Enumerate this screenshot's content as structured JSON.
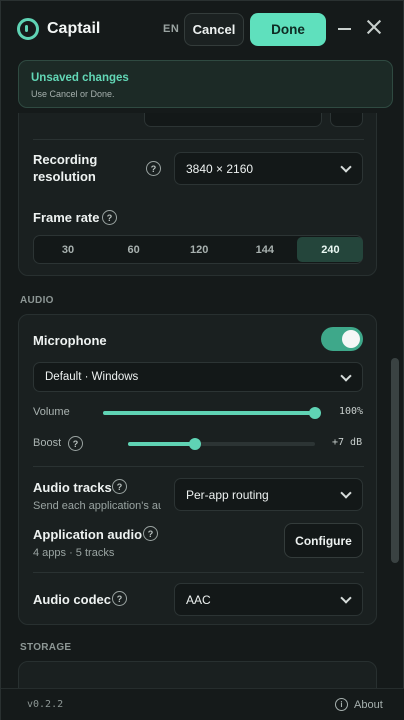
{
  "app": {
    "title": "Captail",
    "language": "EN",
    "logo_icon": "record-icon"
  },
  "header": {
    "cancel_label": "Cancel",
    "done_label": "Done"
  },
  "banner": {
    "title": "Unsaved changes",
    "subtitle": "Use Cancel or Done."
  },
  "video": {
    "resolution": {
      "label": "Recording resolution",
      "value": "3840 × 2160"
    },
    "frame_rate": {
      "label": "Frame rate",
      "options": [
        "30",
        "60",
        "120",
        "144",
        "240"
      ],
      "selected": "240"
    }
  },
  "audio": {
    "section_title": "AUDIO",
    "microphone": {
      "label": "Microphone",
      "enabled": true,
      "device": "Default · Windows"
    },
    "volume": {
      "label": "Volume",
      "value_text": "100%",
      "level": 1.0
    },
    "boost": {
      "label": "Boost",
      "value_text": "+7 dB",
      "level": 0.36
    },
    "audio_tracks": {
      "label": "Audio tracks",
      "description": "Send each application's audio to its own track",
      "value": "Per-app routing"
    },
    "application_audio": {
      "label": "Application audio",
      "summary": "4 apps · 5 tracks",
      "button": "Configure"
    },
    "codec": {
      "label": "Audio codec",
      "value": "AAC"
    }
  },
  "storage": {
    "section_title": "STORAGE"
  },
  "footer": {
    "version": "v0.2.2",
    "about_label": "About"
  },
  "colors": {
    "accent": "#5fe0bd",
    "background": "#151a1a",
    "card": "#1a2020"
  }
}
